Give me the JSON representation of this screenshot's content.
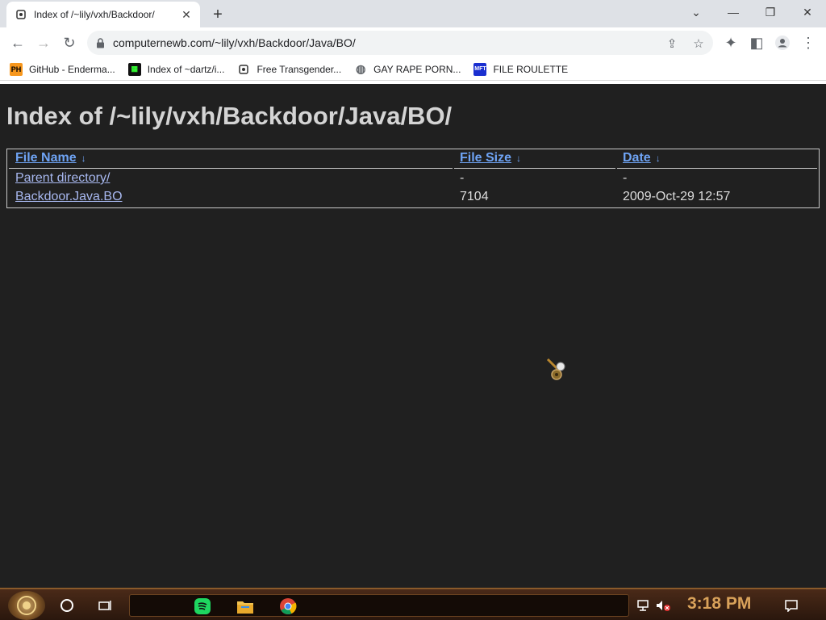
{
  "browser": {
    "tab_title": "Index of /~lily/vxh/Backdoor/",
    "url": "computernewb.com/~lily/vxh/Backdoor/Java/BO/",
    "bookmarks": [
      {
        "label": "GitHub - Enderma...",
        "icon": "PH"
      },
      {
        "label": "Index of ~dartz/i...",
        "icon": ""
      },
      {
        "label": "Free Transgender...",
        "icon": ""
      },
      {
        "label": "GAY RAPE PORN...",
        "icon": ""
      },
      {
        "label": "FILE ROULETTE",
        "icon": "MFT"
      }
    ]
  },
  "page": {
    "heading": "Index of /~lily/vxh/Backdoor/Java/BO/",
    "columns": {
      "name": "File Name",
      "size": "File Size",
      "date": "Date",
      "sort_indicator": "↓"
    },
    "rows": [
      {
        "name": "Parent directory/",
        "size": "-",
        "date": "-"
      },
      {
        "name": "Backdoor.Java.BO",
        "size": "7104",
        "date": "2009-Oct-29 12:57"
      }
    ]
  },
  "taskbar": {
    "clock": "3:18 PM"
  },
  "colors": {
    "page_bg": "#202020",
    "link": "#6fa4f5",
    "visited_link": "#a8b8f0",
    "clock": "#d9a25a"
  }
}
